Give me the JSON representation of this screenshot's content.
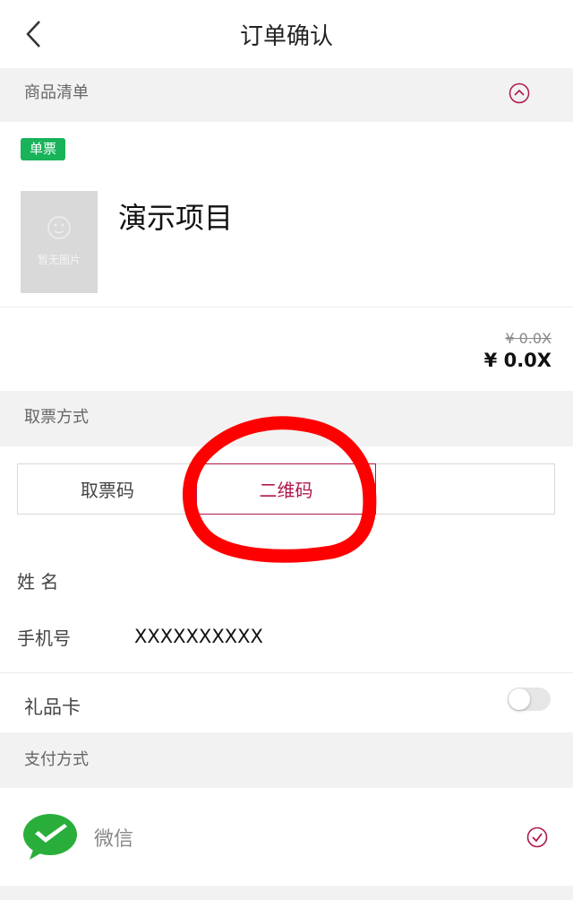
{
  "header": {
    "title": "订单确认"
  },
  "goods": {
    "section_title": "商品清单",
    "badge": "单票",
    "thumbnail_text": "暂无图片",
    "product_name": "演示项目",
    "original_price": "¥ 0.0X",
    "price": "¥ 0.0X"
  },
  "ticket": {
    "section_title": "取票方式",
    "tabs": [
      "取票码",
      "二维码"
    ],
    "active_tab": "二维码",
    "name_label": "姓  名",
    "name_value": "",
    "phone_label": "手机号",
    "phone_value": "XXXXXXXXXX"
  },
  "gift_card": {
    "label": "礼品卡",
    "enabled": false
  },
  "payment": {
    "section_title": "支付方式",
    "method": "微信",
    "selected": true
  },
  "colors": {
    "accent": "#b0164d",
    "badge": "#19b35a",
    "annotation": "#ff0000"
  }
}
